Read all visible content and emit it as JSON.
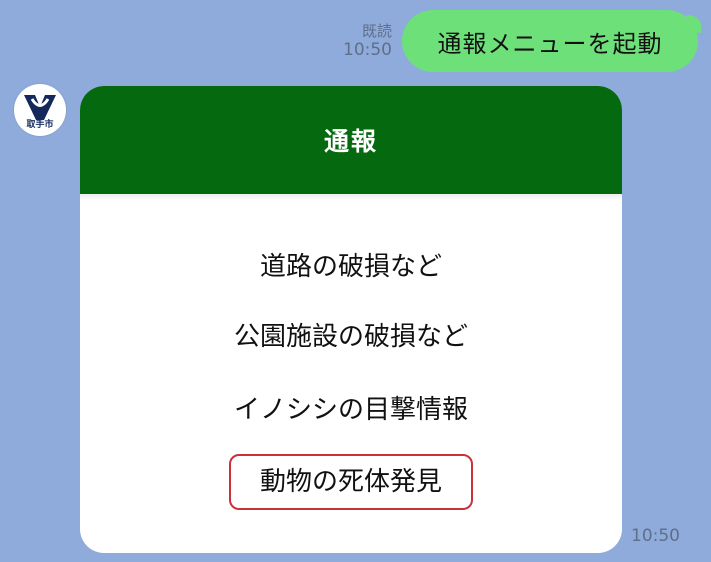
{
  "sent_message": {
    "text": "通報メニューを起動",
    "read_label": "既読",
    "time": "10:50"
  },
  "avatar": {
    "label": "取手市",
    "icon": "toride-city-emblem-icon"
  },
  "menu": {
    "title": "通報",
    "items": [
      {
        "label": "道路の破損など"
      },
      {
        "label": "公園施設の破損など"
      },
      {
        "label": "イノシシの目撃情報"
      },
      {
        "label": "動物の死体発見"
      }
    ],
    "time": "10:50"
  },
  "colors": {
    "background": "#8eabdb",
    "sent_bubble": "#6ee07a",
    "header": "#056a0f",
    "highlight_border": "#c8323a"
  }
}
